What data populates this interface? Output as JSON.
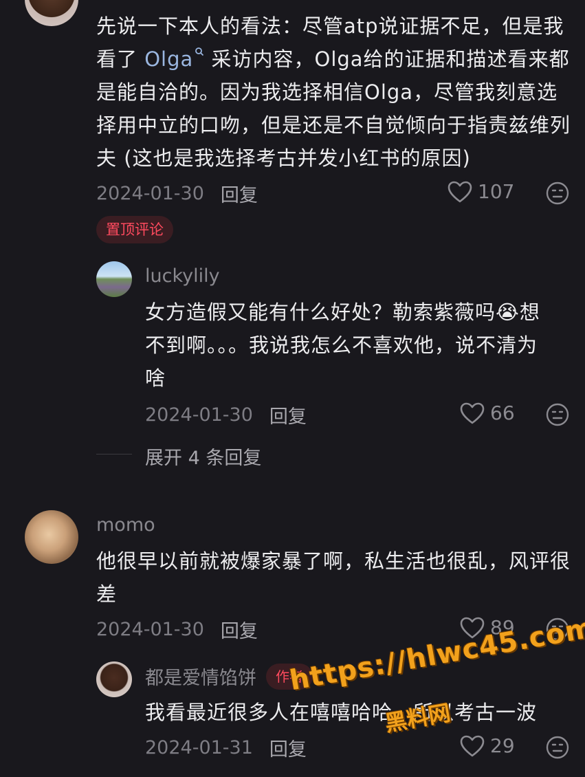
{
  "comments": [
    {
      "text_before_link": "先说一下本人的看法：尽管atp说证据不足，但是我看了 ",
      "link_text": "Olga",
      "text_after_link": " 采访内容，Olga给的证据和描述看来都是能自洽的。因为我选择相信Olga，尽管我刻意选择用中立的口吻，但是还是不自觉倾向于指责兹维列夫 (这也是我选择考古并发小红书的原因)",
      "date": "2024-01-30",
      "reply_label": "回复",
      "likes": "107",
      "pinned_label": "置顶评论"
    },
    {
      "username": "luckylily",
      "text": "女方造假又能有什么好处？勒索紫薇吗😭想不到啊。。。我说我怎么不喜欢他，说不清为啥",
      "date": "2024-01-30",
      "reply_label": "回复",
      "likes": "66",
      "expand_label": "展开 4 条回复"
    },
    {
      "username": "momo",
      "text": "他很早以前就被爆家暴了啊，私生活也很乱，风评很差",
      "date": "2024-01-30",
      "reply_label": "回复",
      "likes": "89"
    },
    {
      "username": "都是爱情馅饼",
      "author_badge": "作者",
      "text": "我看最近很多人在嘻嘻哈哈，所以考古一波",
      "date": "2024-01-31",
      "reply_label": "回复",
      "likes": "29"
    }
  ],
  "watermark": {
    "url": "https://hlwc45.com",
    "name": "黑料网"
  }
}
